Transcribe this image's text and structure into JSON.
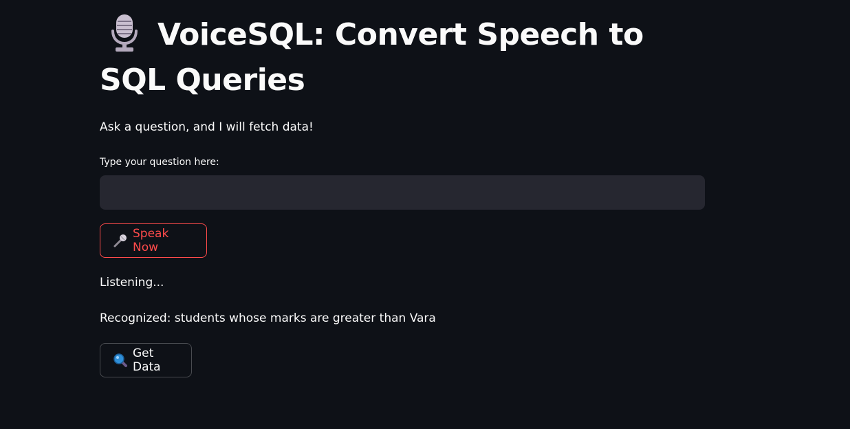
{
  "header": {
    "title": "VoiceSQL: Convert Speech to SQL Queries",
    "title_icon": "studio-microphone-icon"
  },
  "subtitle": "Ask a question, and I will fetch data!",
  "question_input": {
    "label": "Type your question here:",
    "value": "",
    "placeholder": ""
  },
  "speak_button": {
    "label": "Speak Now",
    "icon": "microphone-icon",
    "color": "#ff4b4b"
  },
  "status": {
    "listening": "Listening...",
    "recognized": "Recognized: students whose marks are greater than Vara"
  },
  "get_data_button": {
    "label": "Get Data",
    "icon": "magnifying-glass-icon"
  },
  "colors": {
    "background": "#0e1117",
    "input_background": "#262730",
    "text": "#fafafa",
    "accent": "#ff4b4b"
  }
}
